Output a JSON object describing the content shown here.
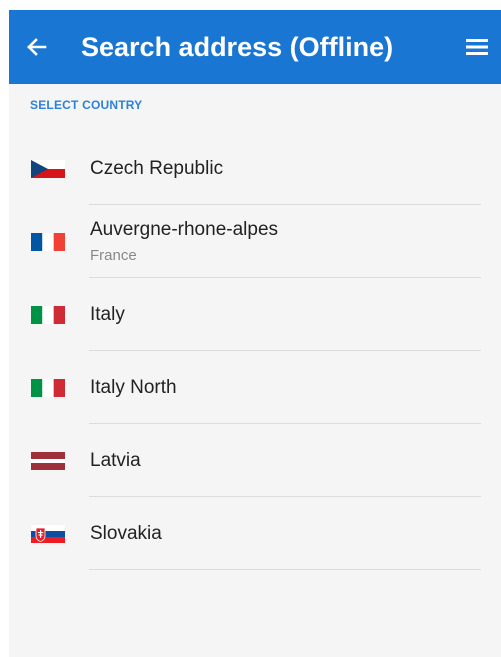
{
  "appbar": {
    "title": "Search address (Offline)",
    "back_icon": "back-arrow-icon",
    "menu_icon": "hamburger-menu-icon",
    "color": "#1976d2"
  },
  "section": {
    "header": "SELECT COUNTRY",
    "color": "#2b82d9"
  },
  "countries": [
    {
      "name": "Czech Republic",
      "subtitle": "",
      "flag_icon": "czech-flag-icon"
    },
    {
      "name": "Auvergne-rhone-alpes",
      "subtitle": "France",
      "flag_icon": "france-flag-icon"
    },
    {
      "name": "Italy",
      "subtitle": "",
      "flag_icon": "italy-flag-icon"
    },
    {
      "name": "Italy North",
      "subtitle": "",
      "flag_icon": "italy-flag-icon"
    },
    {
      "name": "Latvia",
      "subtitle": "",
      "flag_icon": "latvia-flag-icon"
    },
    {
      "name": "Slovakia",
      "subtitle": "",
      "flag_icon": "slovakia-flag-icon"
    }
  ]
}
